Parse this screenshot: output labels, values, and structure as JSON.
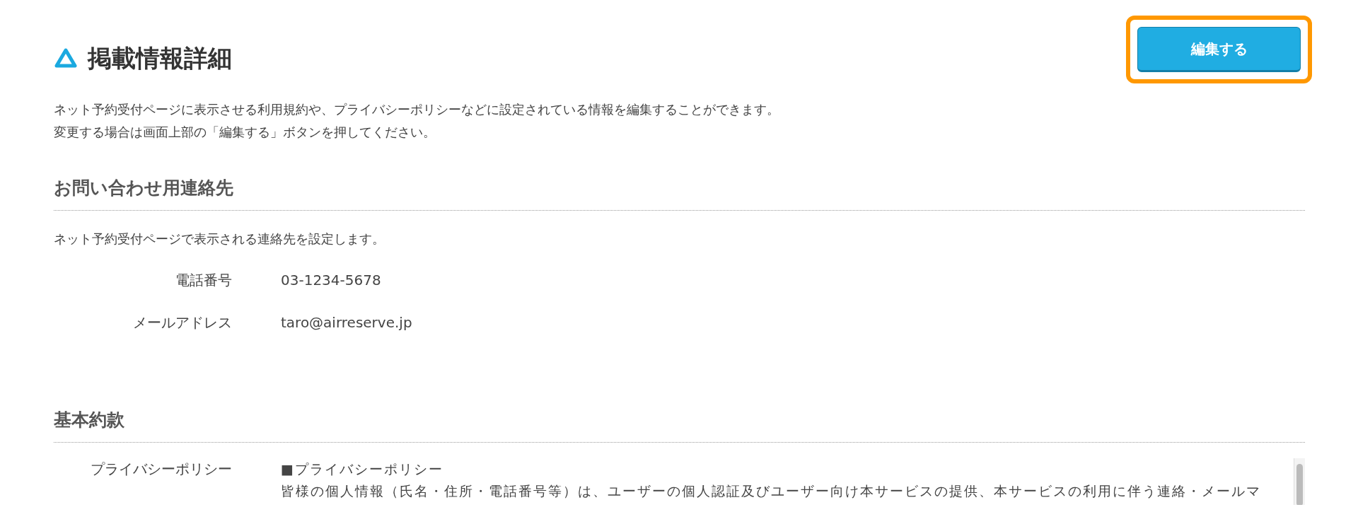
{
  "page": {
    "title": "掲載情報詳細",
    "description": [
      "ネット予約受付ページに表示させる利用規約や、プライバシーポリシーなどに設定されている情報を編集することができます。",
      "変更する場合は画面上部の「編集する」ボタンを押してください。"
    ],
    "edit_button": {
      "label": "編集する",
      "highlighted": true
    }
  },
  "sections": [
    {
      "heading": "お問い合わせ用連絡先",
      "note": "ネット予約受付ページで表示される連絡先を設定します。",
      "fields": [
        {
          "kind": "text",
          "label": "電話番号",
          "value": "03-1234-5678"
        },
        {
          "kind": "text",
          "label": "メールアドレス",
          "value": "taro@airreserve.jp"
        }
      ]
    },
    {
      "heading": "基本約款",
      "fields": [
        {
          "kind": "textarea",
          "label": "プライバシーポリシー",
          "lines": [
            "■プライバシーポリシー",
            "皆様の個人情報（氏名・住所・電話番号等）は、ユーザーの個人認証及びユーザー向け本サービスの提供、本サービスの利用に伴う連絡・メールマ"
          ]
        }
      ]
    }
  ]
}
